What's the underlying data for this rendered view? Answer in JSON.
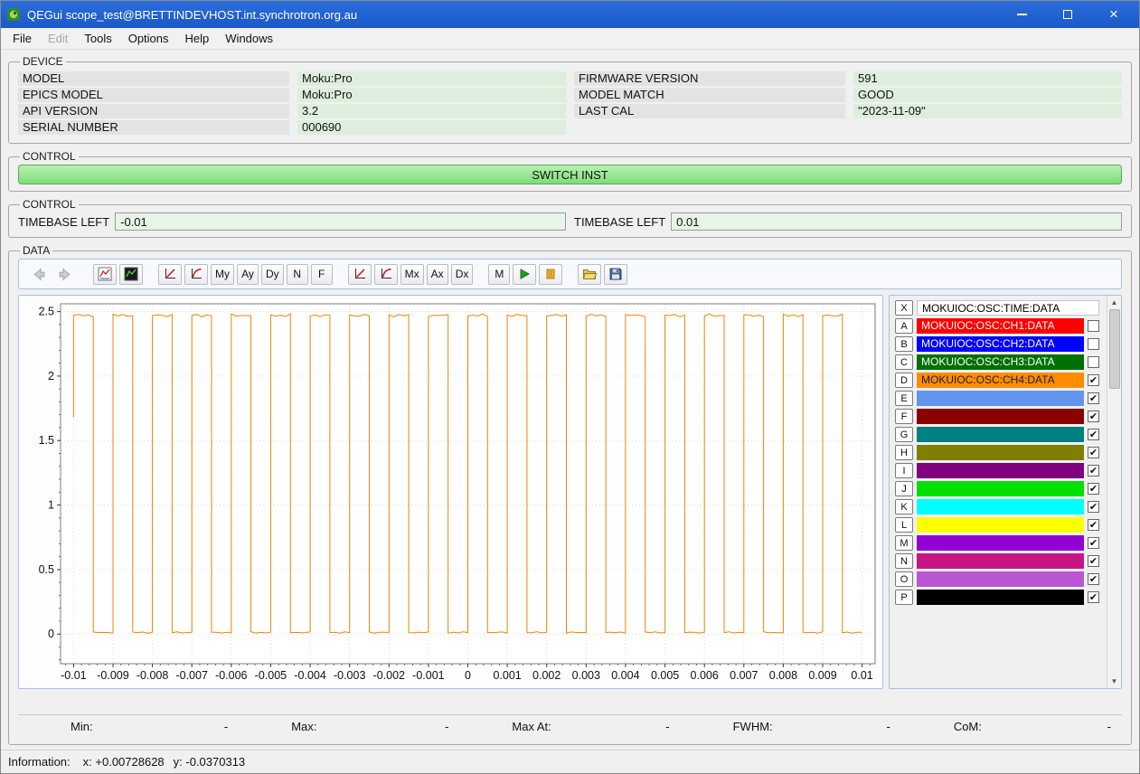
{
  "window": {
    "title": "QEGui scope_test@BRETTINDEVHOST.int.synchrotron.org.au"
  },
  "menu": {
    "items": [
      {
        "label": "File",
        "enabled": true
      },
      {
        "label": "Edit",
        "enabled": false
      },
      {
        "label": "Tools",
        "enabled": true
      },
      {
        "label": "Options",
        "enabled": true
      },
      {
        "label": "Help",
        "enabled": true
      },
      {
        "label": "Windows",
        "enabled": true
      }
    ]
  },
  "device": {
    "title": "DEVICE",
    "left": [
      {
        "label": "MODEL",
        "value": "Moku:Pro"
      },
      {
        "label": "EPICS MODEL",
        "value": "Moku:Pro"
      },
      {
        "label": "API VERSION",
        "value": "3.2"
      },
      {
        "label": "SERIAL NUMBER",
        "value": "000690"
      }
    ],
    "right": [
      {
        "label": "FIRMWARE VERSION",
        "value": "591"
      },
      {
        "label": "MODEL MATCH",
        "value": "GOOD"
      },
      {
        "label": "LAST CAL",
        "value": "\"2023-11-09\""
      }
    ]
  },
  "control_switch": {
    "title": "CONTROL",
    "button_label": "SWITCH INST"
  },
  "control_timebase": {
    "title": "CONTROL",
    "fields": [
      {
        "name": "timebase-left",
        "label": "TIMEBASE LEFT",
        "value": "-0.01"
      },
      {
        "name": "timebase-right",
        "label": "TIMEBASE LEFT",
        "value": "0.01"
      }
    ]
  },
  "data_section": {
    "title": "DATA",
    "toolbar": [
      {
        "type": "icon",
        "name": "nav-back",
        "icon": "arrow-left",
        "enabled": false,
        "flat": true
      },
      {
        "type": "icon",
        "name": "nav-forward",
        "icon": "arrow-right",
        "enabled": false,
        "flat": true
      },
      {
        "type": "gap"
      },
      {
        "type": "icon",
        "name": "plot-options",
        "icon": "plot-white"
      },
      {
        "type": "icon",
        "name": "display-options",
        "icon": "plot-dark"
      },
      {
        "type": "gap"
      },
      {
        "type": "icon",
        "name": "y-scale-linear",
        "icon": "linear-red"
      },
      {
        "type": "icon",
        "name": "y-scale-log",
        "icon": "log-red"
      },
      {
        "type": "text",
        "name": "manual-y",
        "label": "My"
      },
      {
        "type": "text",
        "name": "auto-y",
        "label": "Ay"
      },
      {
        "type": "text",
        "name": "dynamic-y",
        "label": "Dy"
      },
      {
        "type": "text",
        "name": "normalised-y",
        "label": "N"
      },
      {
        "type": "text",
        "name": "fractional-y",
        "label": "F"
      },
      {
        "type": "gap"
      },
      {
        "type": "icon",
        "name": "x-scale-linear",
        "icon": "linear-red"
      },
      {
        "type": "icon",
        "name": "x-scale-log",
        "icon": "log-red"
      },
      {
        "type": "text",
        "name": "manual-x",
        "label": "Mx"
      },
      {
        "type": "text",
        "name": "auto-x",
        "label": "Ax"
      },
      {
        "type": "text",
        "name": "dynamic-x",
        "label": "Dx"
      },
      {
        "type": "gap"
      },
      {
        "type": "text",
        "name": "markers",
        "label": "M"
      },
      {
        "type": "icon",
        "name": "play",
        "icon": "play"
      },
      {
        "type": "icon",
        "name": "pause",
        "icon": "pause"
      },
      {
        "type": "gap"
      },
      {
        "type": "icon",
        "name": "load-config",
        "icon": "folder-open"
      },
      {
        "type": "icon",
        "name": "save-config",
        "icon": "floppy-save"
      }
    ],
    "pv_rows": [
      {
        "letter": "X",
        "pv": "MOKUIOC:OSC:TIME:DATA",
        "bar_color": "#ffffff",
        "text_color": "#000000",
        "has_checkbox": false,
        "checked": false
      },
      {
        "letter": "A",
        "pv": "MOKUIOC:OSC:CH1:DATA",
        "bar_color": "#ff0000",
        "text_color": "#ffffff",
        "has_checkbox": true,
        "checked": false
      },
      {
        "letter": "B",
        "pv": "MOKUIOC:OSC:CH2:DATA",
        "bar_color": "#0000ff",
        "text_color": "#ffffff",
        "has_checkbox": true,
        "checked": false
      },
      {
        "letter": "C",
        "pv": "MOKUIOC:OSC:CH3:DATA",
        "bar_color": "#007000",
        "text_color": "#ffffff",
        "has_checkbox": true,
        "checked": false
      },
      {
        "letter": "D",
        "pv": "MOKUIOC:OSC:CH4:DATA",
        "bar_color": "#ff8c00",
        "text_color": "#202020",
        "has_checkbox": true,
        "checked": true
      },
      {
        "letter": "E",
        "pv": "",
        "bar_color": "#6495ed",
        "has_checkbox": true,
        "checked": true
      },
      {
        "letter": "F",
        "pv": "",
        "bar_color": "#8b0000",
        "has_checkbox": true,
        "checked": true
      },
      {
        "letter": "G",
        "pv": "",
        "bar_color": "#008080",
        "has_checkbox": true,
        "checked": true
      },
      {
        "letter": "H",
        "pv": "",
        "bar_color": "#808000",
        "has_checkbox": true,
        "checked": true
      },
      {
        "letter": "I",
        "pv": "",
        "bar_color": "#800080",
        "has_checkbox": true,
        "checked": true
      },
      {
        "letter": "J",
        "pv": "",
        "bar_color": "#00e000",
        "has_checkbox": true,
        "checked": true
      },
      {
        "letter": "K",
        "pv": "",
        "bar_color": "#00ffff",
        "has_checkbox": true,
        "checked": true
      },
      {
        "letter": "L",
        "pv": "",
        "bar_color": "#ffff00",
        "has_checkbox": true,
        "checked": true
      },
      {
        "letter": "M",
        "pv": "",
        "bar_color": "#9400d3",
        "has_checkbox": true,
        "checked": true
      },
      {
        "letter": "N",
        "pv": "",
        "bar_color": "#c71585",
        "has_checkbox": true,
        "checked": true
      },
      {
        "letter": "O",
        "pv": "",
        "bar_color": "#ba55d3",
        "has_checkbox": true,
        "checked": true
      },
      {
        "letter": "P",
        "pv": "",
        "bar_color": "#000000",
        "has_checkbox": true,
        "checked": true
      }
    ],
    "stats": [
      {
        "label": "Min:",
        "value": "-"
      },
      {
        "label": "Max:",
        "value": "-"
      },
      {
        "label": "Max At:",
        "value": "-"
      },
      {
        "label": "FWHM:",
        "value": "-"
      },
      {
        "label": "CoM:",
        "value": "-"
      }
    ]
  },
  "chart_data": {
    "type": "line",
    "title": "",
    "xlabel": "",
    "ylabel": "",
    "grid": true,
    "legend": "none",
    "xlim": [
      -0.01033,
      0.01033
    ],
    "ylim": [
      -0.23,
      2.56
    ],
    "xticks": [
      -0.01,
      -0.009,
      -0.008,
      -0.007,
      -0.006,
      -0.005,
      -0.004,
      -0.003,
      -0.002,
      -0.001,
      0,
      0.001,
      0.002,
      0.003,
      0.004,
      0.005,
      0.006,
      0.007,
      0.008,
      0.009,
      0.01
    ],
    "xtick_labels": [
      "-0.01",
      "-0.009",
      "-0.008",
      "-0.007",
      "-0.006",
      "-0.005",
      "-0.004",
      "-0.003",
      "-0.002",
      "-0.001",
      "0",
      "0.001",
      "0.002",
      "0.003",
      "0.004",
      "0.005",
      "0.006",
      "0.007",
      "0.008",
      "0.009",
      "0.01"
    ],
    "yticks": [
      0,
      0.5,
      1,
      1.5,
      2,
      2.5
    ],
    "ytick_labels": [
      "0",
      "0.5",
      "1",
      "1.5",
      "2",
      "2.5"
    ],
    "x_minor_step": 0.0002,
    "y_minor_step": 0.1,
    "series": [
      {
        "name": "MOKUIOC:OSC:CH4:DATA",
        "color": "#ee8500",
        "waveform": "square",
        "x_start": -0.01,
        "x_end": 0.01,
        "period": 0.001,
        "duty": 0.5,
        "y_high": 2.47,
        "y_low": 0.012,
        "first_point_y": 1.68
      }
    ]
  },
  "statusbar": {
    "label": "Information:",
    "x": "x: +0.00728628",
    "y": "y: -0.0370313"
  }
}
